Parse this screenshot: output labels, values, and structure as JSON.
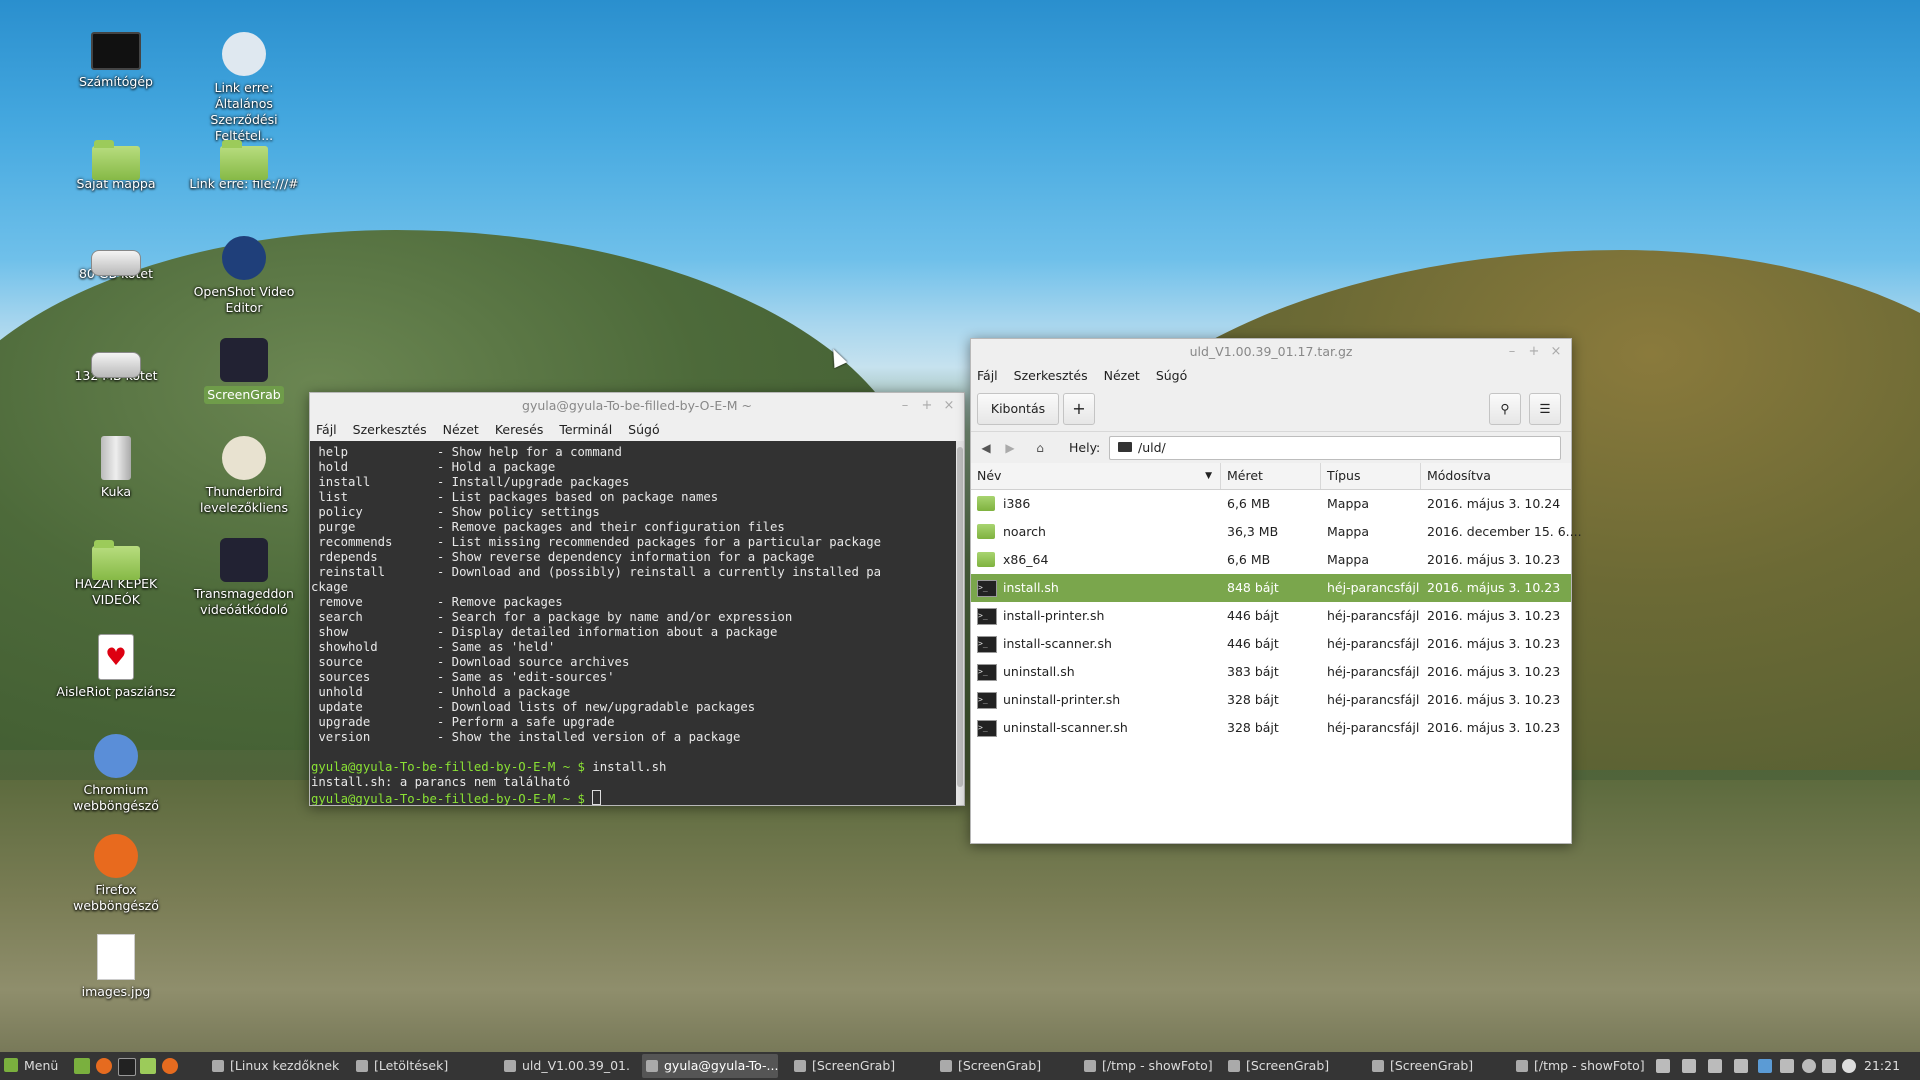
{
  "desktop_icons": [
    {
      "label": "Számítógép",
      "icon": "monitor-icon"
    },
    {
      "label": "Link erre: Általános Szerződési Feltétel...",
      "icon": "web-link-icon"
    },
    {
      "label": "Saját mappa",
      "icon": "home-folder-icon"
    },
    {
      "label": "Link erre: file:///#",
      "icon": "folder-link-icon"
    },
    {
      "label": "80 GB kötet",
      "icon": "drive-icon"
    },
    {
      "label": "OpenShot Video Editor",
      "icon": "openshot-icon"
    },
    {
      "label": "132 MB kötet",
      "icon": "drive-icon"
    },
    {
      "label": "ScreenGrab",
      "icon": "screengrab-icon"
    },
    {
      "label": "Kuka",
      "icon": "trash-icon"
    },
    {
      "label": "Thunderbird levelezőkliens",
      "icon": "thunderbird-icon"
    },
    {
      "label": "HAZAI KÉPEK VIDEÓK",
      "icon": "folder-icon"
    },
    {
      "label": "Transmageddon videóátkódoló",
      "icon": "transmageddon-icon"
    },
    {
      "label": "AisleRiot pasziánsz",
      "icon": "cards-icon"
    },
    {
      "label": "Chromium webböngésző",
      "icon": "chromium-icon"
    },
    {
      "label": "Firefox webböngésző",
      "icon": "firefox-icon"
    },
    {
      "label": "images.jpg",
      "icon": "image-file-icon"
    }
  ],
  "terminal": {
    "title": "gyula@gyula-To-be-filled-by-O-E-M ~",
    "menu": [
      "Fájl",
      "Szerkesztés",
      "Nézet",
      "Keresés",
      "Terminál",
      "Súgó"
    ],
    "commands": [
      {
        "name": "help",
        "desc": "Show help for a command"
      },
      {
        "name": "hold",
        "desc": "Hold a package"
      },
      {
        "name": "install",
        "desc": "Install/upgrade packages"
      },
      {
        "name": "list",
        "desc": "List packages based on package names"
      },
      {
        "name": "policy",
        "desc": "Show policy settings"
      },
      {
        "name": "purge",
        "desc": "Remove packages and their configuration files"
      },
      {
        "name": "recommends",
        "desc": "List missing recommended packages for a particular package"
      },
      {
        "name": "rdepends",
        "desc": "Show reverse dependency information for a package"
      },
      {
        "name": "reinstall",
        "desc": "Download and (possibly) reinstall a currently installed package"
      },
      {
        "name": "remove",
        "desc": "Remove packages"
      },
      {
        "name": "search",
        "desc": "Search for a package by name and/or expression"
      },
      {
        "name": "show",
        "desc": "Display detailed information about a package"
      },
      {
        "name": "showhold",
        "desc": "Same as 'held'"
      },
      {
        "name": "source",
        "desc": "Download source archives"
      },
      {
        "name": "sources",
        "desc": "Same as 'edit-sources'"
      },
      {
        "name": "unhold",
        "desc": "Unhold a package"
      },
      {
        "name": "update",
        "desc": "Download lists of new/upgradable packages"
      },
      {
        "name": "upgrade",
        "desc": "Perform a safe upgrade"
      },
      {
        "name": "version",
        "desc": "Show the installed version of a package"
      }
    ],
    "prompt": "gyula@gyula-To-be-filled-by-O-E-M ~ $",
    "typed_command": "install.sh",
    "error_output": "install.sh: a parancs nem található",
    "colors": {
      "background": "#323232",
      "prompt": "#8ae234",
      "text": "#e8e8e8"
    }
  },
  "archive": {
    "title": "uld_V1.00.39_01.17.tar.gz",
    "menu": [
      "Fájl",
      "Szerkesztés",
      "Nézet",
      "Súgó"
    ],
    "extract_label": "Kibontás",
    "add_label": "+",
    "location_label": "Hely:",
    "location_value": "/uld/",
    "columns": [
      "Név",
      "Méret",
      "Típus",
      "Módosítva"
    ],
    "files": [
      {
        "name": "i386",
        "size": "6,6 MB",
        "type": "Mappa",
        "modified": "2016. május 3. 10.24",
        "icon": "folder-icon"
      },
      {
        "name": "noarch",
        "size": "36,3 MB",
        "type": "Mappa",
        "modified": "2016. december 15. 6....",
        "icon": "folder-icon"
      },
      {
        "name": "x86_64",
        "size": "6,6 MB",
        "type": "Mappa",
        "modified": "2016. május 3. 10.23",
        "icon": "folder-icon"
      },
      {
        "name": "install.sh",
        "size": "848 bájt",
        "type": "héj-parancsfájl",
        "modified": "2016. május 3. 10.23",
        "icon": "script-icon",
        "selected": true
      },
      {
        "name": "install-printer.sh",
        "size": "446 bájt",
        "type": "héj-parancsfájl",
        "modified": "2016. május 3. 10.23",
        "icon": "script-icon"
      },
      {
        "name": "install-scanner.sh",
        "size": "446 bájt",
        "type": "héj-parancsfájl",
        "modified": "2016. május 3. 10.23",
        "icon": "script-icon"
      },
      {
        "name": "uninstall.sh",
        "size": "383 bájt",
        "type": "héj-parancsfájl",
        "modified": "2016. május 3. 10.23",
        "icon": "script-icon"
      },
      {
        "name": "uninstall-printer.sh",
        "size": "328 bájt",
        "type": "héj-parancsfájl",
        "modified": "2016. május 3. 10.23",
        "icon": "script-icon"
      },
      {
        "name": "uninstall-scanner.sh",
        "size": "328 bájt",
        "type": "héj-parancsfájl",
        "modified": "2016. május 3. 10.23",
        "icon": "script-icon"
      }
    ],
    "selection_color": "#7aa64c"
  },
  "taskbar": {
    "menu_label": "Menü",
    "tasks": [
      {
        "label": "[Linux kezdőknek..."
      },
      {
        "label": "[Letöltések]"
      },
      {
        "label": "uld_V1.00.39_01...."
      },
      {
        "label": "gyula@gyula-To-...",
        "active": true
      },
      {
        "label": "[ScreenGrab]"
      },
      {
        "label": "[ScreenGrab]"
      },
      {
        "label": "[/tmp - showFoto]"
      },
      {
        "label": "[ScreenGrab]"
      },
      {
        "label": "[ScreenGrab]"
      },
      {
        "label": "[/tmp - showFoto]"
      }
    ],
    "clock": "21:21",
    "background_color": "#353535"
  }
}
